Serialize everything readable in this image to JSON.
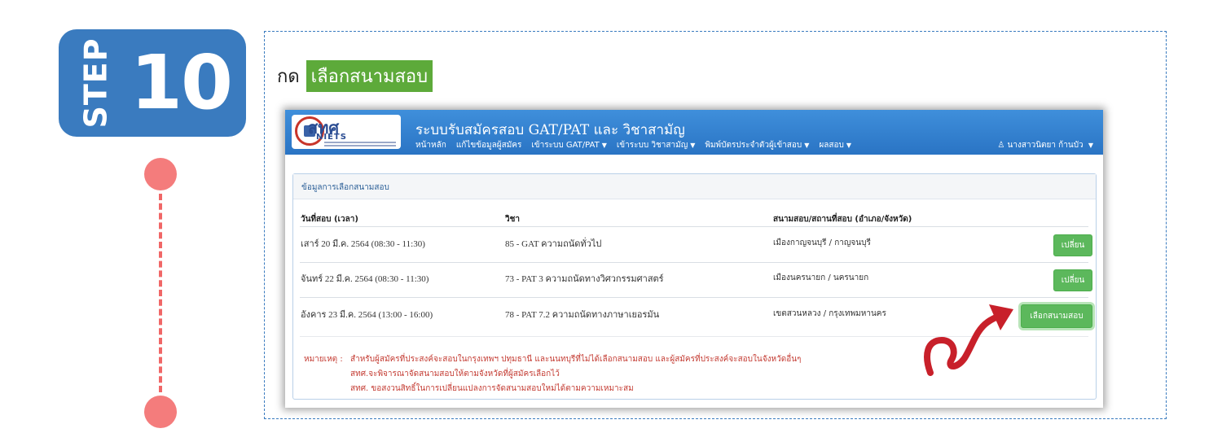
{
  "step": {
    "label": "STEP",
    "number": "10"
  },
  "instruction": {
    "prefix": "กด",
    "highlight": "เลือกสนามสอบ"
  },
  "app": {
    "logo": {
      "main": "สทศ",
      "sub": "NIETS"
    },
    "title": "ระบบรับสมัครสอบ GAT/PAT และ วิชาสามัญ",
    "menu": [
      {
        "label": "หน้าหลัก",
        "caret": false
      },
      {
        "label": "แก้ไขข้อมูลผู้สมัคร",
        "caret": false
      },
      {
        "label": "เข้าระบบ GAT/PAT",
        "caret": true
      },
      {
        "label": "เข้าระบบ วิชาสามัญ",
        "caret": true
      },
      {
        "label": "พิมพ์บัตรประจำตัวผู้เข้าสอบ",
        "caret": true
      },
      {
        "label": "ผลสอบ",
        "caret": true
      }
    ],
    "user": "นางสาวนิตยา ก้านบัว",
    "panel_title": "ข้อมูลการเลือกสนามสอบ",
    "columns": [
      "วันที่สอบ (เวลา)",
      "วิชา",
      "สนามสอบ/สถานที่สอบ (อำเภอ/จังหวัด)"
    ],
    "rows": [
      {
        "date": "เสาร์ 20 มี.ค. 2564   (08:30 - 11:30)",
        "subject": "85 - GAT ความถนัดทั่วไป",
        "venue": "เมืองกาญจนบุรี  /  กาญจนบุรี",
        "action": "เปลี่ยน"
      },
      {
        "date": "จันทร์ 22 มี.ค. 2564   (08:30 - 11:30)",
        "subject": "73 - PAT 3 ความถนัดทางวิศวกรรมศาสตร์",
        "venue": "เมืองนครนายก  /  นครนายก",
        "action": "เปลี่ยน"
      },
      {
        "date": "อังคาร 23 มี.ค. 2564   (13:00 - 16:00)",
        "subject": "78 - PAT 7.2 ความถนัดทางภาษาเยอรมัน",
        "venue": "เขตสวนหลวง  /  กรุงเทพมหานคร",
        "action": "เลือกสนามสอบ"
      }
    ],
    "note_label": "หมายเหตุ :",
    "notes": [
      "สำหรับผู้สมัครที่ประสงค์จะสอบในกรุงเทพฯ ปทุมธานี และนนทบุรีที่ไม่ได้เลือกสนามสอบ และผู้สมัครที่ประสงค์จะสอบในจังหวัดอื่นๆ",
      "สทศ.จะพิจารณาจัดสนามสอบให้ตามจังหวัดที่ผู้สมัครเลือกไว้",
      "สทศ. ขอสงวนสิทธิ์ในการเปลี่ยนแปลงการจัดสนามสอบใหม่ได้ตามความเหมาะสม"
    ]
  },
  "colors": {
    "badge": "#3a7bbf",
    "dot": "#f47c7c",
    "highlight": "#5daa3a",
    "arrow": "#c8202a",
    "nav": "#2a74c4",
    "button": "#5cb85c"
  }
}
